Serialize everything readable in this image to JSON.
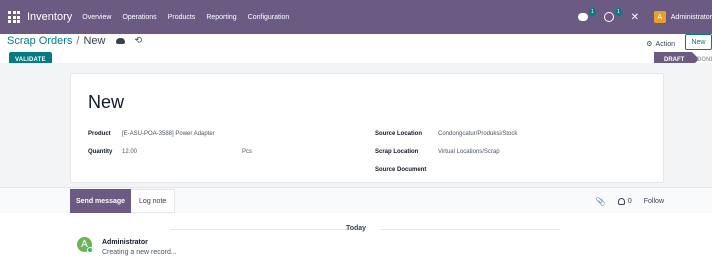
{
  "navbar": {
    "app_name": "Inventory",
    "menu": [
      "Overview",
      "Operations",
      "Products",
      "Reporting",
      "Configuration"
    ],
    "messages_count": "1",
    "activities_count": "1",
    "user_initial": "A",
    "user_name": "Administrator",
    "colors": {
      "bar": "#6b5b83",
      "accent": "#017e84"
    }
  },
  "control": {
    "breadcrumb_parent": "Scrap Orders",
    "breadcrumb_sep": "/",
    "breadcrumb_current": "New",
    "action_label": "Action",
    "new_label": "New",
    "validate_label": "VALIDATE",
    "stage_current": "DRAFT",
    "stage_next": "DONE"
  },
  "form": {
    "title": "New",
    "product_label": "Product",
    "product_value": "[E-ASU-POA-3588] Power Adapter",
    "quantity_label": "Quantity",
    "quantity_value": "12.00",
    "uom_value": "Pcs",
    "source_location_label": "Source Location",
    "source_location_value": "Condongcatur/Produksi/Stock",
    "scrap_location_label": "Scrap Location",
    "scrap_location_value": "Virtual Locations/Scrap",
    "source_document_label": "Source Document",
    "source_document_value": ""
  },
  "chatter": {
    "send_message_label": "Send message",
    "log_note_label": "Log note",
    "followers_count": "0",
    "follow_label": "Follow",
    "date_separator": "Today",
    "message_author": "Administrator",
    "message_author_initial": "A",
    "message_body": "Creating a new record..."
  }
}
